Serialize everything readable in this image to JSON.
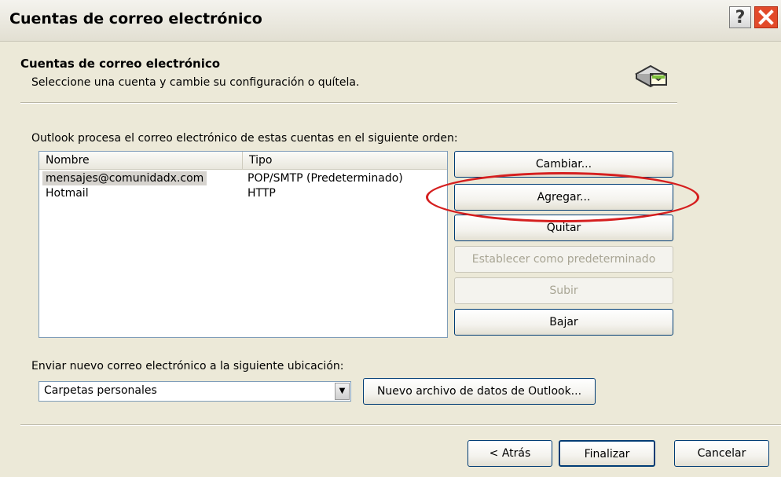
{
  "window": {
    "title": "Cuentas de correo electrónico",
    "help_glyph": "?"
  },
  "header": {
    "title": "Cuentas de correo electrónico",
    "subtitle": "Seleccione una cuenta y cambie su configuración o quítela.",
    "icon": "mail-accounts-icon"
  },
  "accounts": {
    "caption": "Outlook procesa el correo electrónico de estas cuentas en el siguiente orden:",
    "columns": [
      "Nombre",
      "Tipo"
    ],
    "rows": [
      {
        "name": "mensajes@comunidadx.com",
        "type": "POP/SMTP (Predeterminado)",
        "selected": true
      },
      {
        "name": "Hotmail",
        "type": "HTTP",
        "selected": false
      }
    ]
  },
  "actions": {
    "change": "Cambiar...",
    "add": "Agregar...",
    "remove": "Quitar",
    "set_default": "Establecer como predeterminado",
    "up": "Subir",
    "down": "Bajar"
  },
  "delivery": {
    "caption": "Enviar nuevo correo electrónico a la siguiente ubicación:",
    "location": "Carpetas personales",
    "new_data_file": "Nuevo archivo de datos de Outlook..."
  },
  "footer": {
    "back": "< Atrás",
    "finish": "Finalizar",
    "cancel": "Cancelar"
  },
  "annotation": {
    "ring_color": "#d51f1f"
  }
}
